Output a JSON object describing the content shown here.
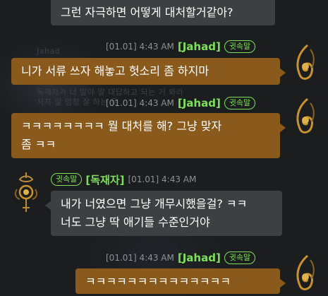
{
  "background_lines": [
    "Jahad",
    "독재자가 너 말야 말 대답하고 되는 거 봐라",
    "저저 말 엄청 잘 하는 듯"
  ],
  "messages": [
    {
      "text": "그런 자극하면 어떻게 대처할거같아?"
    },
    {
      "time": "[01.01] 4:43 AM",
      "name": "[Jahad]",
      "badge": "귓속말",
      "text": "니가 서류 쓰자 해놓고 헛소리 좀 하지마"
    },
    {
      "time": "[01.01] 4:43 AM",
      "name": "[Jahad]",
      "badge": "귓속말",
      "line1": "ㅋㅋㅋㅋㅋㅋㅋㅋ 뭘 대처를 해? 그냥 맞자",
      "line2": "좀 ㅋㅋ"
    },
    {
      "badge": "귓속말",
      "name": "[독재자]",
      "time": "[01.01] 4:43 AM",
      "line1": "내가 너였으면 그냥 개무시했을걸? ㅋㅋ",
      "line2": "너도 그냥 딱 애기들 수준인거야"
    },
    {
      "time": "[01.01] 4:43 AM",
      "name": "[Jahad]",
      "badge": "귓속말",
      "text": "ㅋㅋㅋㅋㅋㅋㅋㅋㅋㅋㅋㅋㅋㅋ"
    }
  ],
  "colors": {
    "gold_bubble": "#8a5a1c",
    "gray_bubble": "#3e3f42",
    "name_green": "#7ee05a",
    "time_gray": "#8c9196"
  },
  "icons": [
    "jahad-emblem-icon",
    "dictator-emblem-icon"
  ]
}
